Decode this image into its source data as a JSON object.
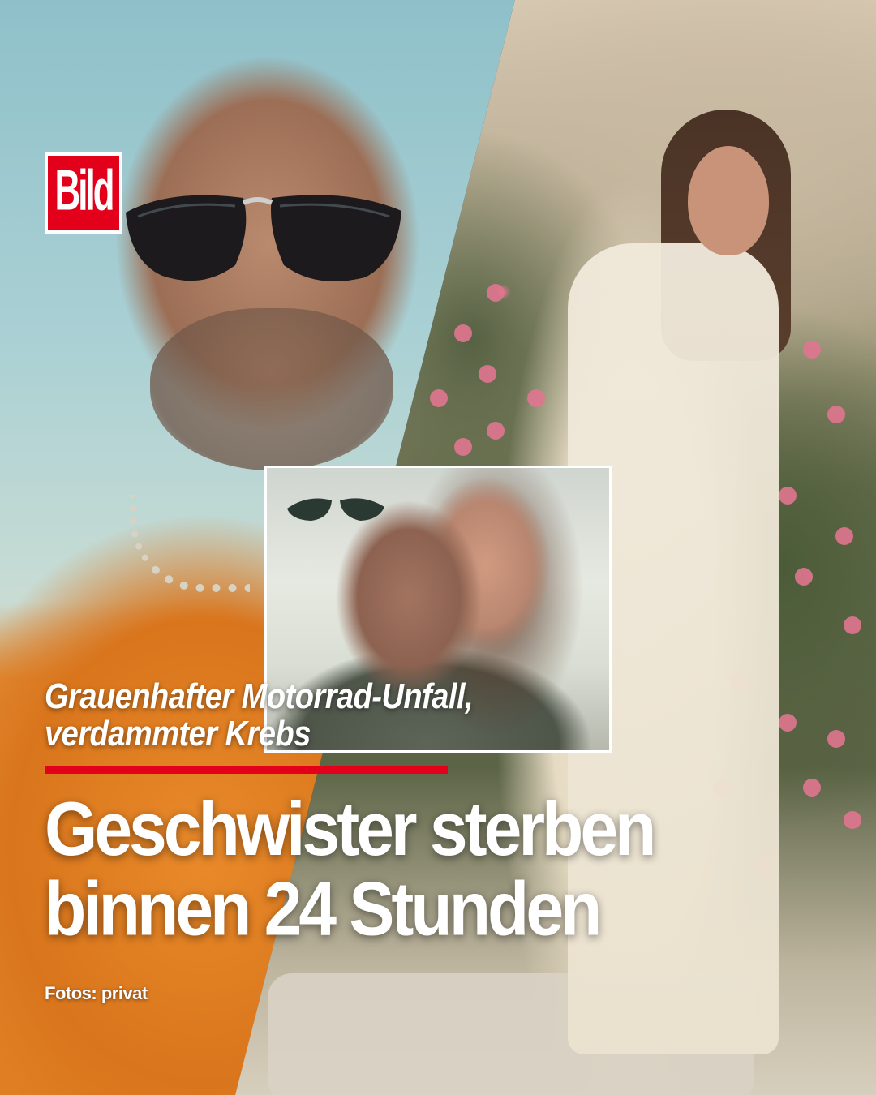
{
  "brand": {
    "logo_text": "Bild",
    "accent_color": "#e2001a"
  },
  "images": {
    "left_photo": "man-with-sunglasses-orange-shirt",
    "right_photo": "woman-in-white-dress-garden",
    "inset_photo": "man-and-woman-selfie"
  },
  "article": {
    "kicker_line_1": "Grauenhafter Motorrad-Unfall,",
    "kicker_line_2": "verdammter Krebs",
    "headline_line_1": "Geschwister sterben",
    "headline_line_2": "binnen 24 Stunden",
    "credit": "Fotos: privat"
  }
}
